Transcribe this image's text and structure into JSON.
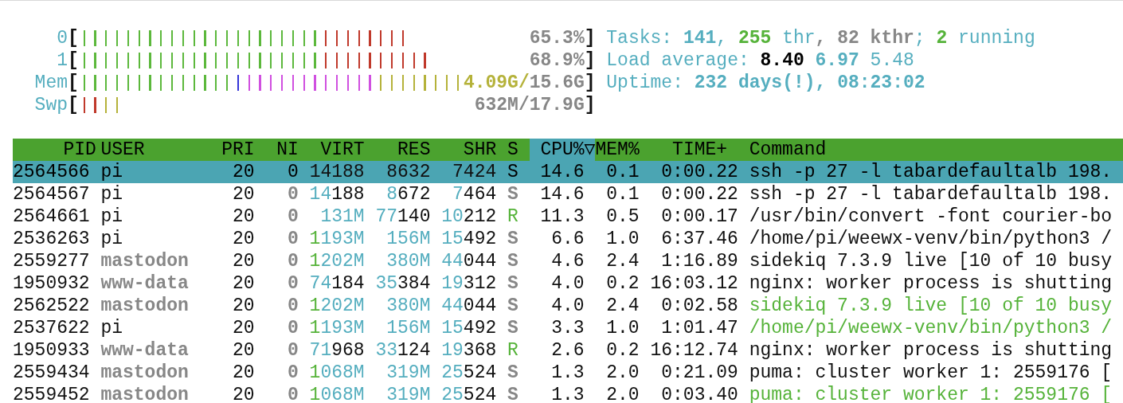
{
  "meters": {
    "open": "[",
    "close": "]",
    "items": [
      {
        "label": "0",
        "value": [
          {
            "text": "65.3%",
            "kind": "total"
          }
        ],
        "bars": [
          {
            "color": "#5cb83c"
          },
          {
            "color": "#5cb83c"
          },
          {
            "color": "#5cb83c"
          },
          {
            "color": "#5cb83c"
          },
          {
            "color": "#5cb83c"
          },
          {
            "color": "#5cb83c"
          },
          {
            "color": "#5cb83c"
          },
          {
            "color": "#5cb83c"
          },
          {
            "color": "#5cb83c"
          },
          {
            "color": "#5cb83c"
          },
          {
            "color": "#5cb83c"
          },
          {
            "color": "#5cb83c"
          },
          {
            "color": "#5cb83c"
          },
          {
            "color": "#5cb83c"
          },
          {
            "color": "#5cb83c"
          },
          {
            "color": "#5cb83c"
          },
          {
            "color": "#5cb83c"
          },
          {
            "color": "#5cb83c"
          },
          {
            "color": "#5cb83c"
          },
          {
            "color": "#5cb83c"
          },
          {
            "color": "#5cb83c"
          },
          {
            "color": "#5cb83c"
          },
          {
            "color": "#c0392b"
          },
          {
            "color": "#c0392b"
          },
          {
            "color": "#c0392b"
          },
          {
            "color": "#c0392b"
          },
          {
            "color": "#c0392b"
          },
          {
            "color": "#c0392b"
          },
          {
            "color": "#c0392b"
          },
          {
            "color": "#c0392b"
          }
        ]
      },
      {
        "label": "1",
        "value": [
          {
            "text": "68.9%",
            "kind": "total"
          }
        ],
        "bars": [
          {
            "color": "#5cb83c"
          },
          {
            "color": "#5cb83c"
          },
          {
            "color": "#5cb83c"
          },
          {
            "color": "#5cb83c"
          },
          {
            "color": "#5cb83c"
          },
          {
            "color": "#5cb83c"
          },
          {
            "color": "#5cb83c"
          },
          {
            "color": "#5cb83c"
          },
          {
            "color": "#5cb83c"
          },
          {
            "color": "#5cb83c"
          },
          {
            "color": "#5cb83c"
          },
          {
            "color": "#5cb83c"
          },
          {
            "color": "#5cb83c"
          },
          {
            "color": "#5cb83c"
          },
          {
            "color": "#5cb83c"
          },
          {
            "color": "#5cb83c"
          },
          {
            "color": "#5cb83c"
          },
          {
            "color": "#5cb83c"
          },
          {
            "color": "#5cb83c"
          },
          {
            "color": "#5cb83c"
          },
          {
            "color": "#5cb83c"
          },
          {
            "color": "#5cb83c"
          },
          {
            "color": "#c0392b"
          },
          {
            "color": "#c0392b"
          },
          {
            "color": "#c0392b"
          },
          {
            "color": "#c0392b"
          },
          {
            "color": "#c0392b"
          },
          {
            "color": "#c0392b"
          },
          {
            "color": "#c0392b"
          },
          {
            "color": "#c0392b"
          },
          {
            "color": "#c0392b"
          },
          {
            "color": "#c0392b"
          }
        ]
      },
      {
        "label": "Mem",
        "value": [
          {
            "text": "4.09G/",
            "kind": "cache"
          },
          {
            "text": "15.6G",
            "kind": "total"
          }
        ],
        "bars": [
          {
            "color": "#5cb83c"
          },
          {
            "color": "#5cb83c"
          },
          {
            "color": "#5cb83c"
          },
          {
            "color": "#5cb83c"
          },
          {
            "color": "#5cb83c"
          },
          {
            "color": "#5cb83c"
          },
          {
            "color": "#5cb83c"
          },
          {
            "color": "#5cb83c"
          },
          {
            "color": "#5cb83c"
          },
          {
            "color": "#5cb83c"
          },
          {
            "color": "#5cb83c"
          },
          {
            "color": "#5cb83c"
          },
          {
            "color": "#5cb83c"
          },
          {
            "color": "#5cb83c"
          },
          {
            "color": "#3535d8"
          },
          {
            "color": "#d050e0"
          },
          {
            "color": "#d050e0"
          },
          {
            "color": "#d050e0"
          },
          {
            "color": "#d050e0"
          },
          {
            "color": "#d050e0"
          },
          {
            "color": "#d050e0"
          },
          {
            "color": "#d050e0"
          },
          {
            "color": "#d050e0"
          },
          {
            "color": "#d050e0"
          },
          {
            "color": "#d050e0"
          },
          {
            "color": "#d050e0"
          },
          {
            "color": "#d050e0"
          },
          {
            "color": "#b5b23a"
          },
          {
            "color": "#b5b23a"
          },
          {
            "color": "#b5b23a"
          },
          {
            "color": "#b5b23a"
          },
          {
            "color": "#b5b23a"
          },
          {
            "color": "#b5b23a"
          },
          {
            "color": "#b5b23a"
          },
          {
            "color": "#b5b23a"
          }
        ]
      },
      {
        "label": "Swp",
        "value": [
          {
            "text": "632M/17.9G",
            "kind": "total"
          }
        ],
        "bars": [
          {
            "color": "#c0392b"
          },
          {
            "color": "#c0392b"
          },
          {
            "color": "#b5b23a"
          },
          {
            "color": "#b5b23a"
          }
        ]
      }
    ]
  },
  "stats": [
    {
      "segments": [
        {
          "text": "Tasks: ",
          "kind": "label"
        },
        {
          "text": "141",
          "kind": "value"
        },
        {
          "text": ", ",
          "kind": "label"
        },
        {
          "text": "255",
          "kind": "green"
        },
        {
          "text": " thr",
          "kind": "label"
        },
        {
          "text": ", 82 kthr",
          "kind": "shadow"
        },
        {
          "text": "; ",
          "kind": "label"
        },
        {
          "text": "2",
          "kind": "green"
        },
        {
          "text": " running",
          "kind": "label"
        }
      ]
    },
    {
      "segments": [
        {
          "text": "Load average: ",
          "kind": "label"
        },
        {
          "text": "8.40 ",
          "kind": "strong"
        },
        {
          "text": "6.97 ",
          "kind": "value"
        },
        {
          "text": "5.48",
          "kind": "label"
        }
      ]
    },
    {
      "segments": [
        {
          "text": "Uptime: ",
          "kind": "label"
        },
        {
          "text": "232 days(!), 08:23:02",
          "kind": "value"
        }
      ]
    }
  ],
  "table": {
    "columns": [
      {
        "label": "PID",
        "sorted": false
      },
      {
        "label": "USER",
        "sorted": false
      },
      {
        "label": "PRI",
        "sorted": false
      },
      {
        "label": "NI",
        "sorted": false
      },
      {
        "label": "VIRT",
        "sorted": false
      },
      {
        "label": "RES",
        "sorted": false
      },
      {
        "label": "SHR",
        "sorted": false
      },
      {
        "label": "S",
        "sorted": false
      },
      {
        "label": "CPU%▽",
        "sorted": true
      },
      {
        "label": "MEM%",
        "sorted": false
      },
      {
        "label": "TIME+",
        "sorted": false
      },
      {
        "label": "Command",
        "sorted": false
      }
    ],
    "rows": [
      {
        "selected": true,
        "pid": "2564566",
        "user": "pi",
        "user_dimmed": false,
        "pri": "20",
        "ni": "0",
        "virt": [
          {
            "text": "14188"
          }
        ],
        "res": [
          {
            "text": "8632"
          }
        ],
        "shr": [
          {
            "text": "7424"
          }
        ],
        "state": "S",
        "running": false,
        "cpu": "14.6",
        "mem": "0.1",
        "time": "0:00.22",
        "command": "ssh -p 27 -l tabardefaultalb 198.",
        "thread": false
      },
      {
        "selected": false,
        "pid": "2564567",
        "user": "pi",
        "user_dimmed": false,
        "pri": "20",
        "ni": "0",
        "virt": [
          {
            "text": "14",
            "kind": "mid"
          },
          {
            "text": "188",
            "kind": "plain"
          }
        ],
        "res": [
          {
            "text": "8",
            "kind": "mid"
          },
          {
            "text": "672",
            "kind": "plain"
          }
        ],
        "shr": [
          {
            "text": "7",
            "kind": "mid"
          },
          {
            "text": "464",
            "kind": "plain"
          }
        ],
        "state": "S",
        "running": false,
        "cpu": "14.6",
        "mem": "0.1",
        "time": "0:00.22",
        "command": "ssh -p 27 -l tabardefaultalb 198.",
        "thread": false
      },
      {
        "selected": false,
        "pid": "2564661",
        "user": "pi",
        "user_dimmed": false,
        "pri": "20",
        "ni": "0",
        "virt": [
          {
            "text": "131M",
            "kind": "mid"
          }
        ],
        "res": [
          {
            "text": "77",
            "kind": "mid"
          },
          {
            "text": "140",
            "kind": "plain"
          }
        ],
        "shr": [
          {
            "text": "10",
            "kind": "mid"
          },
          {
            "text": "212",
            "kind": "plain"
          }
        ],
        "state": "R",
        "running": true,
        "cpu": "11.3",
        "mem": "0.5",
        "time": "0:00.17",
        "command": "/usr/bin/convert -font courier-bo",
        "thread": false
      },
      {
        "selected": false,
        "pid": "2536263",
        "user": "pi",
        "user_dimmed": false,
        "pri": "20",
        "ni": "0",
        "virt": [
          {
            "text": "1",
            "kind": "big"
          },
          {
            "text": "193M",
            "kind": "mid"
          }
        ],
        "res": [
          {
            "text": "156M",
            "kind": "mid"
          }
        ],
        "shr": [
          {
            "text": "15",
            "kind": "mid"
          },
          {
            "text": "492",
            "kind": "plain"
          }
        ],
        "state": "S",
        "running": false,
        "cpu": "6.6",
        "mem": "1.0",
        "time": "6:37.46",
        "command": "/home/pi/weewx-venv/bin/python3 /",
        "thread": false
      },
      {
        "selected": false,
        "pid": "2559277",
        "user": "mastodon",
        "user_dimmed": true,
        "pri": "20",
        "ni": "0",
        "virt": [
          {
            "text": "1",
            "kind": "big"
          },
          {
            "text": "202M",
            "kind": "mid"
          }
        ],
        "res": [
          {
            "text": "380M",
            "kind": "mid"
          }
        ],
        "shr": [
          {
            "text": "44",
            "kind": "mid"
          },
          {
            "text": "044",
            "kind": "plain"
          }
        ],
        "state": "S",
        "running": false,
        "cpu": "4.6",
        "mem": "2.4",
        "time": "1:16.89",
        "command": "sidekiq 7.3.9 live [10 of 10 busy",
        "thread": false
      },
      {
        "selected": false,
        "pid": "1950932",
        "user": "www-data",
        "user_dimmed": true,
        "pri": "20",
        "ni": "0",
        "virt": [
          {
            "text": "74",
            "kind": "mid"
          },
          {
            "text": "184",
            "kind": "plain"
          }
        ],
        "res": [
          {
            "text": "35",
            "kind": "mid"
          },
          {
            "text": "384",
            "kind": "plain"
          }
        ],
        "shr": [
          {
            "text": "19",
            "kind": "mid"
          },
          {
            "text": "312",
            "kind": "plain"
          }
        ],
        "state": "S",
        "running": false,
        "cpu": "4.0",
        "mem": "0.2",
        "time": "16:03.12",
        "command": "nginx: worker process is shutting",
        "thread": false
      },
      {
        "selected": false,
        "pid": "2562522",
        "user": "mastodon",
        "user_dimmed": true,
        "pri": "20",
        "ni": "0",
        "virt": [
          {
            "text": "1",
            "kind": "big"
          },
          {
            "text": "202M",
            "kind": "mid"
          }
        ],
        "res": [
          {
            "text": "380M",
            "kind": "mid"
          }
        ],
        "shr": [
          {
            "text": "44",
            "kind": "mid"
          },
          {
            "text": "044",
            "kind": "plain"
          }
        ],
        "state": "S",
        "running": false,
        "cpu": "4.0",
        "mem": "2.4",
        "time": "0:02.58",
        "command": "sidekiq 7.3.9 live [10 of 10 busy",
        "thread": true
      },
      {
        "selected": false,
        "pid": "2537622",
        "user": "pi",
        "user_dimmed": false,
        "pri": "20",
        "ni": "0",
        "virt": [
          {
            "text": "1",
            "kind": "big"
          },
          {
            "text": "193M",
            "kind": "mid"
          }
        ],
        "res": [
          {
            "text": "156M",
            "kind": "mid"
          }
        ],
        "shr": [
          {
            "text": "15",
            "kind": "mid"
          },
          {
            "text": "492",
            "kind": "plain"
          }
        ],
        "state": "S",
        "running": false,
        "cpu": "3.3",
        "mem": "1.0",
        "time": "1:01.47",
        "command": "/home/pi/weewx-venv/bin/python3 /",
        "thread": true
      },
      {
        "selected": false,
        "pid": "1950933",
        "user": "www-data",
        "user_dimmed": true,
        "pri": "20",
        "ni": "0",
        "virt": [
          {
            "text": "71",
            "kind": "mid"
          },
          {
            "text": "968",
            "kind": "plain"
          }
        ],
        "res": [
          {
            "text": "33",
            "kind": "mid"
          },
          {
            "text": "124",
            "kind": "plain"
          }
        ],
        "shr": [
          {
            "text": "19",
            "kind": "mid"
          },
          {
            "text": "368",
            "kind": "plain"
          }
        ],
        "state": "R",
        "running": true,
        "cpu": "2.6",
        "mem": "0.2",
        "time": "16:12.74",
        "command": "nginx: worker process is shutting",
        "thread": false
      },
      {
        "selected": false,
        "pid": "2559434",
        "user": "mastodon",
        "user_dimmed": true,
        "pri": "20",
        "ni": "0",
        "virt": [
          {
            "text": "1",
            "kind": "big"
          },
          {
            "text": "068M",
            "kind": "mid"
          }
        ],
        "res": [
          {
            "text": "319M",
            "kind": "mid"
          }
        ],
        "shr": [
          {
            "text": "25",
            "kind": "mid"
          },
          {
            "text": "524",
            "kind": "plain"
          }
        ],
        "state": "S",
        "running": false,
        "cpu": "1.3",
        "mem": "2.0",
        "time": "0:21.09",
        "command": "puma: cluster worker 1: 2559176 [",
        "thread": false
      },
      {
        "selected": false,
        "pid": "2559452",
        "user": "mastodon",
        "user_dimmed": true,
        "pri": "20",
        "ni": "0",
        "virt": [
          {
            "text": "1",
            "kind": "big"
          },
          {
            "text": "068M",
            "kind": "mid"
          }
        ],
        "res": [
          {
            "text": "319M",
            "kind": "mid"
          }
        ],
        "shr": [
          {
            "text": "25",
            "kind": "mid"
          },
          {
            "text": "524",
            "kind": "plain"
          }
        ],
        "state": "S",
        "running": false,
        "cpu": "1.3",
        "mem": "2.0",
        "time": "0:03.40",
        "command": "puma: cluster worker 1: 2559176 [",
        "thread": true
      }
    ]
  }
}
